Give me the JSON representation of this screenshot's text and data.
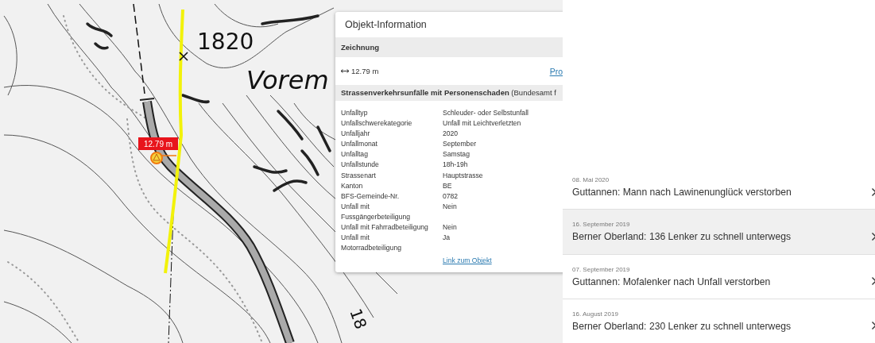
{
  "map": {
    "labels": [
      {
        "kind": "elevation",
        "text": "1820"
      },
      {
        "kind": "place",
        "text": "Vorem"
      },
      {
        "kind": "contour",
        "text": "18"
      }
    ],
    "measurement": "12.79 m"
  },
  "popup": {
    "title": "Objekt-Information",
    "drawing_section": {
      "heading": "Zeichnung",
      "length": "12.79 m",
      "link": "Pro"
    },
    "data_section": {
      "heading": "**Strassenverkehrsunfälle mit Personenschaden** (Bundesamt f",
      "rows": [
        {
          "key_lines": [
            "Unfalltyp"
          ],
          "value": "Schleuder- oder Selbstunfall"
        },
        {
          "key_lines": [
            "Unfallschwerekategorie"
          ],
          "value": "Unfall mit Leichtverletzten"
        },
        {
          "key_lines": [
            "Unfalljahr"
          ],
          "value": "2020"
        },
        {
          "key_lines": [
            "Unfallmonat"
          ],
          "value": "September"
        },
        {
          "key_lines": [
            "Unfalltag"
          ],
          "value": "Samstag"
        },
        {
          "key_lines": [
            "Unfallstunde"
          ],
          "value": "18h-19h"
        },
        {
          "key_lines": [
            "Strassenart"
          ],
          "value": "Hauptstrasse"
        },
        {
          "key_lines": [
            "Kanton"
          ],
          "value": "BE"
        },
        {
          "key_lines": [
            "BFS-Gemeinde-Nr."
          ],
          "value": "0782"
        },
        {
          "key_lines": [
            "Unfall mit",
            "Fussgängerbeteiligung"
          ],
          "value": "Nein"
        },
        {
          "key_lines": [
            "Unfall mit Fahrradbeteiligung"
          ],
          "value": "Nein"
        },
        {
          "key_lines": [
            "Unfall mit",
            "Motorradbeteiligung"
          ],
          "value": "Ja"
        }
      ],
      "link": "Link zum Objekt"
    }
  },
  "news": [
    {
      "date": "08. Mai 2020",
      "title": "Guttannen: Mann nach Lawinenunglück verstorben",
      "selected": false
    },
    {
      "date": "16. September 2019",
      "title": "Berner Oberland: 136 Lenker zu schnell unterwegs",
      "selected": true
    },
    {
      "date": "07. September 2019",
      "title": "Guttannen: Mofalenker nach Unfall verstorben",
      "selected": false
    },
    {
      "date": "16. August 2019",
      "title": "Berner Oberland: 230 Lenker zu schnell unterwegs",
      "selected": false
    }
  ]
}
